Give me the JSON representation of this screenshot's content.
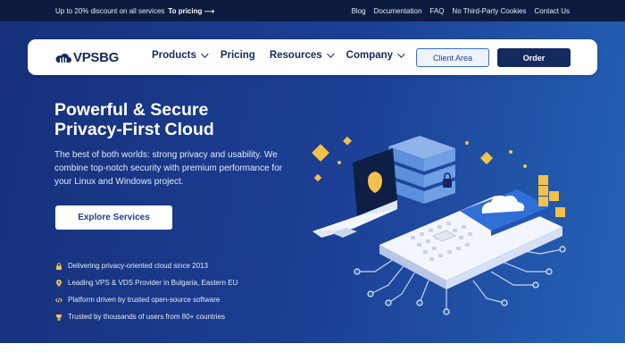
{
  "topbar": {
    "promo_text": "Up to 20% discount on all services",
    "promo_link": "To pricing",
    "links": [
      "Blog",
      "Documentation",
      "FAQ",
      "No Third-Party Cookies",
      "Contact Us"
    ]
  },
  "header": {
    "logo_text": "VPSBG",
    "nav": [
      "Products",
      "Pricing",
      "Resources",
      "Company"
    ],
    "client_area_label": "Client Area",
    "order_label": "Order"
  },
  "hero": {
    "title_line1": "Powerful & Secure",
    "title_line2": "Privacy-First Cloud",
    "subtitle": "The best of both worlds: strong privacy and usability. We combine top-notch security with premium performance for your Linux and Windows project.",
    "cta_label": "Explore Services",
    "features": [
      {
        "icon": "lock-icon",
        "text": "Delivering privacy-oriented cloud since 2013"
      },
      {
        "icon": "location-pin-icon",
        "text": "Leading VPS & VDS Provider in Bulgaria, Eastern EU"
      },
      {
        "icon": "code-icon",
        "text": "Platform driven by trusted open-source software"
      },
      {
        "icon": "trophy-icon",
        "text": "Trusted by thousands of users from 80+ countries"
      }
    ]
  },
  "colors": {
    "topbar_bg": "#0d1b3e",
    "hero_bg_start": "#16307a",
    "hero_bg_end": "#2563b5",
    "brand_navy": "#14295e",
    "accent_gold": "#f2c14e"
  }
}
